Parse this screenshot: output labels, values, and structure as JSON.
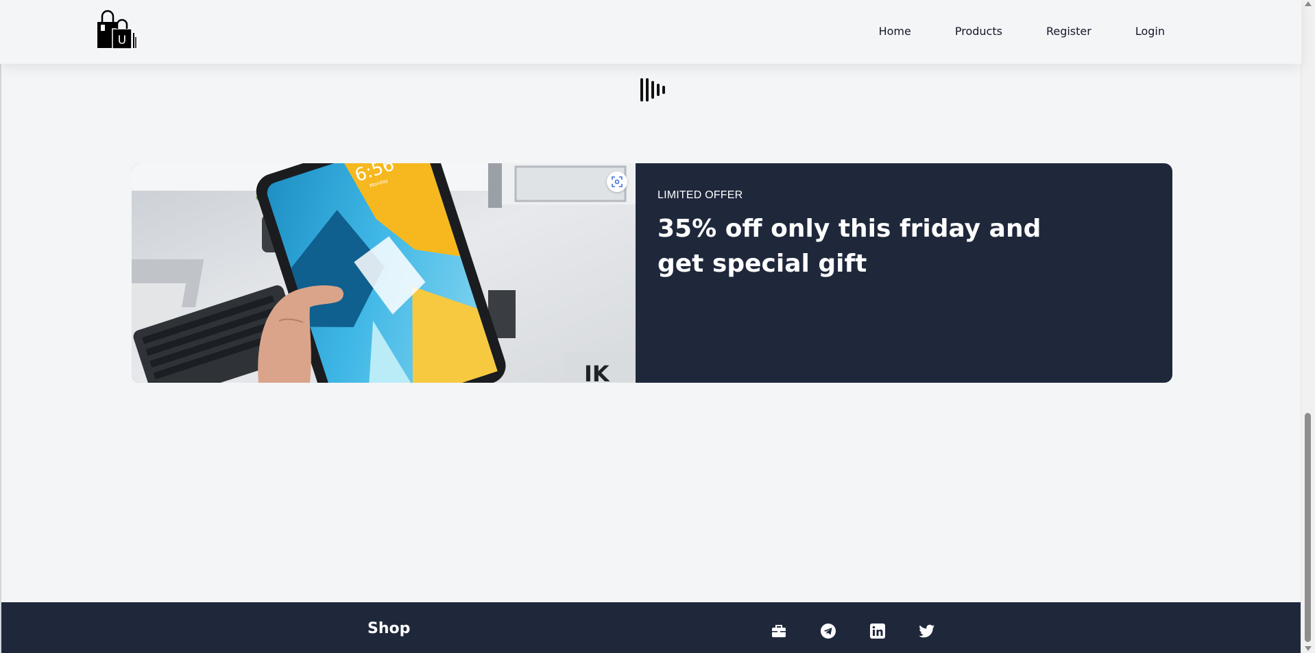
{
  "nav": {
    "items": [
      "Home",
      "Products",
      "Register",
      "Login"
    ]
  },
  "logo": {
    "letter": "U"
  },
  "offer": {
    "kicker": "LIMITED OFFER",
    "title": "35% off only this friday and get special gift",
    "image_clock": "6:56",
    "image_date": "Monday"
  },
  "footer": {
    "brand": "Shop",
    "social_icons": [
      "briefcase-icon",
      "telegram-icon",
      "linkedin-icon",
      "twitter-icon"
    ]
  },
  "colors": {
    "background": "#f4f5f7",
    "dark_navy": "#1f283b",
    "text_dark": "#111827",
    "white": "#ffffff"
  }
}
